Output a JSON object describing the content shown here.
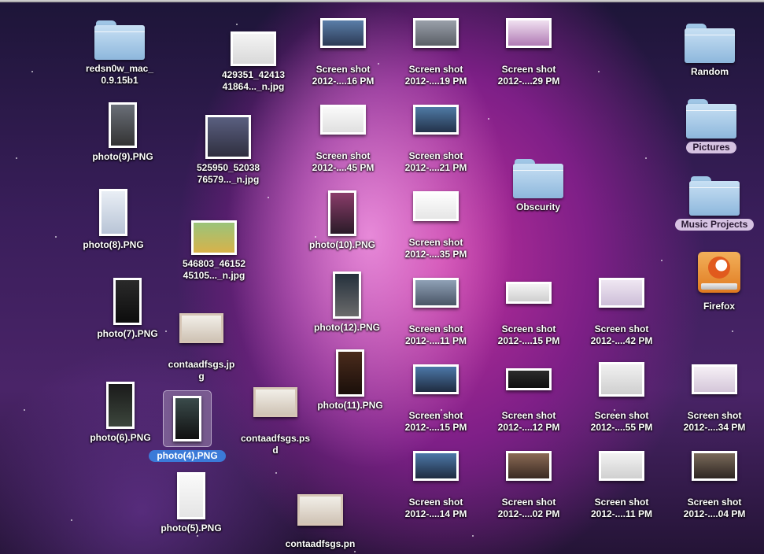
{
  "desktop": {
    "folders": [
      {
        "name": "redsn0w_mac_\n0.9.15b1"
      },
      {
        "name": "Random"
      },
      {
        "name": "Pictures"
      },
      {
        "name": "Obscurity"
      },
      {
        "name": "Music Projects"
      }
    ],
    "app": {
      "name": "Firefox",
      "icon": "firefox-drive-icon"
    },
    "photos": [
      {
        "name": "photo(9).PNG"
      },
      {
        "name": "photo(8).PNG"
      },
      {
        "name": "photo(7).PNG"
      },
      {
        "name": "photo(6).PNG"
      },
      {
        "name": "photo(4).PNG",
        "selected": true
      },
      {
        "name": "photo(5).PNG"
      },
      {
        "name": "photo(10).PNG"
      },
      {
        "name": "photo(12).PNG"
      },
      {
        "name": "photo(11).PNG"
      }
    ],
    "images": [
      {
        "name": "429351_42413\n41864..._n.jpg"
      },
      {
        "name": "525950_52038\n76579..._n.jpg"
      },
      {
        "name": "546803_46152\n45105..._n.jpg"
      },
      {
        "name": "contaadfsgs.jp\ng"
      },
      {
        "name": "contaadfsgs.ps\nd"
      },
      {
        "name": "contaadfsgs.pn"
      }
    ],
    "screenshots": [
      {
        "name": "Screen shot\n2012-....16 PM"
      },
      {
        "name": "Screen shot\n2012-....19 PM"
      },
      {
        "name": "Screen shot\n2012-....29 PM"
      },
      {
        "name": "Screen shot\n2012-....45 PM"
      },
      {
        "name": "Screen shot\n2012-....21 PM"
      },
      {
        "name": "Screen shot\n2012-....35 PM"
      },
      {
        "name": "Screen shot\n2012-....11 PM"
      },
      {
        "name": "Screen shot\n2012-....15 PM"
      },
      {
        "name": "Screen shot\n2012-....42 PM"
      },
      {
        "name": "Screen shot\n2012-....15 PM"
      },
      {
        "name": "Screen shot\n2012-....12 PM"
      },
      {
        "name": "Screen shot\n2012-....55 PM"
      },
      {
        "name": "Screen shot\n2012-....34 PM"
      },
      {
        "name": "Screen shot\n2012-....14 PM"
      },
      {
        "name": "Screen shot\n2012-....02 PM"
      },
      {
        "name": "Screen shot\n2012-....11 PM"
      },
      {
        "name": "Screen shot\n2012-....04 PM"
      }
    ]
  },
  "colors": {
    "selection_label": "#3b7ad8",
    "folder_blue": "#8db7dc",
    "label_pill": "#e4d0ee"
  }
}
